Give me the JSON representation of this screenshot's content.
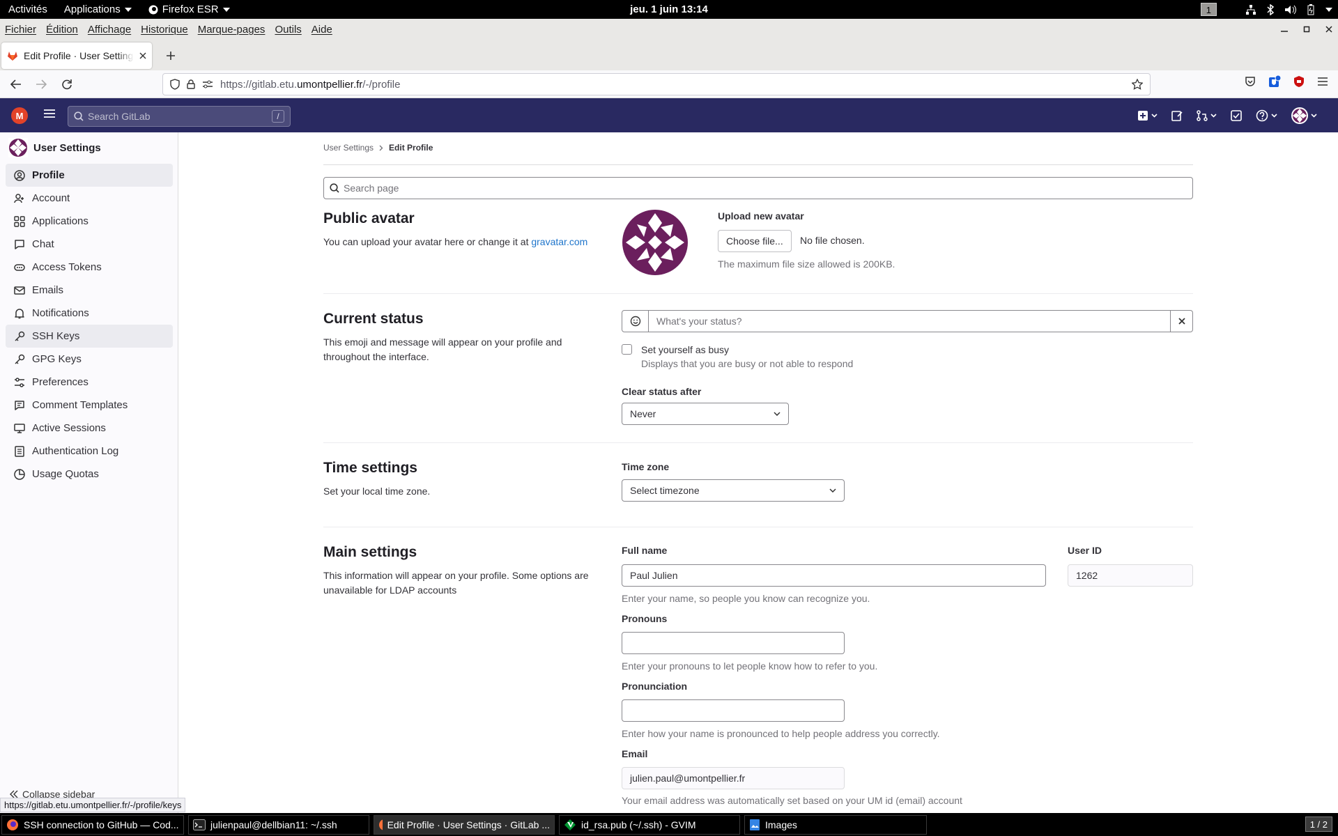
{
  "gnome": {
    "activities": "Activités",
    "applications": "Applications",
    "firefox": "Firefox ESR",
    "clock": "jeu. 1 juin  13:14",
    "workspace": "1"
  },
  "menubar": [
    "Fichier",
    "Édition",
    "Affichage",
    "Historique",
    "Marque-pages",
    "Outils",
    "Aide"
  ],
  "tab": {
    "title": "Edit Profile · User Settings · GitLab"
  },
  "url": {
    "prefix": "https://gitlab.etu.",
    "domain": "umontpellier.fr",
    "path": "/-/profile"
  },
  "gitlab": {
    "search_placeholder": "Search GitLab",
    "search_shortcut": "/",
    "logo_letter": "M"
  },
  "sidebar": {
    "title": "User Settings",
    "items": [
      {
        "label": "Profile",
        "icon": "profile-icon"
      },
      {
        "label": "Account",
        "icon": "account-icon"
      },
      {
        "label": "Applications",
        "icon": "applications-icon"
      },
      {
        "label": "Chat",
        "icon": "chat-icon"
      },
      {
        "label": "Access Tokens",
        "icon": "token-icon"
      },
      {
        "label": "Emails",
        "icon": "mail-icon"
      },
      {
        "label": "Notifications",
        "icon": "bell-icon"
      },
      {
        "label": "SSH Keys",
        "icon": "key-icon"
      },
      {
        "label": "GPG Keys",
        "icon": "key-icon"
      },
      {
        "label": "Preferences",
        "icon": "preferences-icon"
      },
      {
        "label": "Comment Templates",
        "icon": "comment-icon"
      },
      {
        "label": "Active Sessions",
        "icon": "monitor-icon"
      },
      {
        "label": "Authentication Log",
        "icon": "log-icon"
      },
      {
        "label": "Usage Quotas",
        "icon": "quota-icon"
      }
    ],
    "collapse": "Collapse sidebar"
  },
  "breadcrumb": {
    "parent": "User Settings",
    "current": "Edit Profile"
  },
  "page_search_placeholder": "Search page",
  "avatar": {
    "title": "Public avatar",
    "desc_prefix": "You can upload your avatar here or change it at ",
    "desc_link": "gravatar.com",
    "upload_label": "Upload new avatar",
    "choose_button": "Choose file...",
    "no_file": "No file chosen.",
    "max_size": "The maximum file size allowed is 200KB."
  },
  "status": {
    "title": "Current status",
    "desc": "This emoji and message will appear on your profile and throughout the interface.",
    "placeholder": "What's your status?",
    "busy_label": "Set yourself as busy",
    "busy_help": "Displays that you are busy or not able to respond",
    "clear_label": "Clear status after",
    "clear_value": "Never"
  },
  "time": {
    "title": "Time settings",
    "desc": "Set your local time zone.",
    "tz_label": "Time zone",
    "tz_value": "Select timezone"
  },
  "main_settings": {
    "title": "Main settings",
    "desc": "This information will appear on your profile. Some options are unavailable for LDAP accounts",
    "fullname_label": "Full name",
    "fullname_value": "Paul Julien",
    "fullname_help": "Enter your name, so people you know can recognize you.",
    "userid_label": "User ID",
    "userid_value": "1262",
    "pronouns_label": "Pronouns",
    "pronouns_value": "",
    "pronouns_help": "Enter your pronouns to let people know how to refer to you.",
    "pronunciation_label": "Pronunciation",
    "pronunciation_value": "",
    "pronunciation_help": "Enter how your name is pronounced to help people address you correctly.",
    "email_label": "Email",
    "email_value": "julien.paul@umontpellier.fr",
    "email_help": "Your email address was automatically set based on your UM id (email) account"
  },
  "status_url": "https://gitlab.etu.umontpellier.fr/-/profile/keys",
  "taskbar": [
    {
      "label": "SSH connection to GitHub — Cod...",
      "icon": "firefox-icon"
    },
    {
      "label": "julienpaul@dellbian11: ~/.ssh",
      "icon": "terminal-icon"
    },
    {
      "label": "Edit Profile · User Settings · GitLab ...",
      "icon": "firefox-icon"
    },
    {
      "label": "id_rsa.pub (~/.ssh) - GVIM",
      "icon": "vim-icon"
    },
    {
      "label": "Images",
      "icon": "image-viewer-icon"
    }
  ],
  "pager": "1 / 2",
  "colors": {
    "gitlab_header": "#292961",
    "link": "#1f75cb",
    "brand_avatar": "#6b1f5d"
  }
}
